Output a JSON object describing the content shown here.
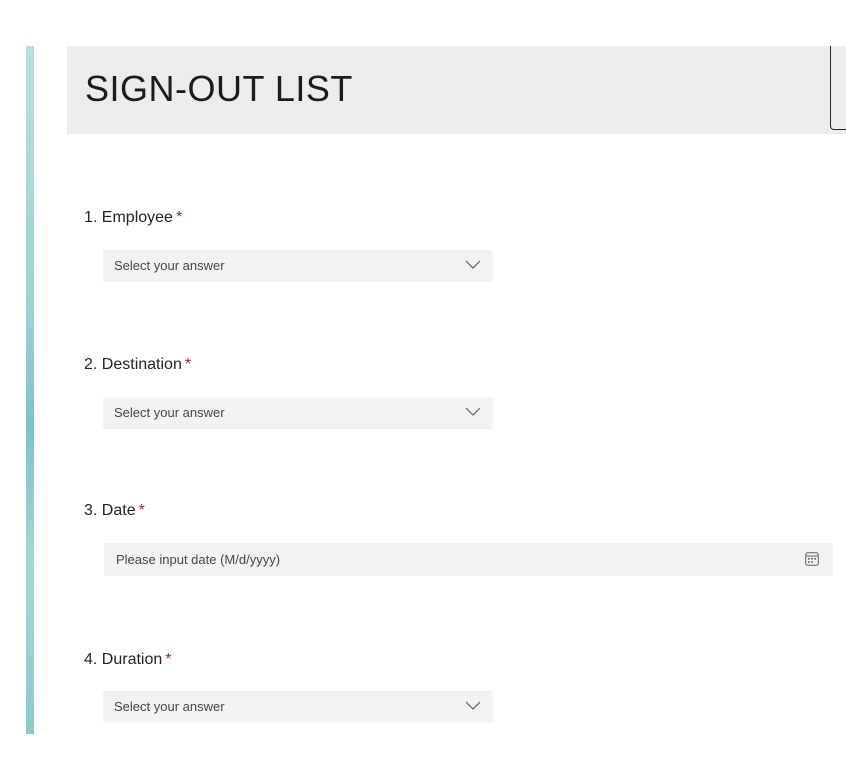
{
  "form": {
    "title": "SIGN-OUT LIST",
    "accent_color": "#9dd0d2",
    "required_marker_color": "#a4262c"
  },
  "questions": [
    {
      "label": "1. Employee",
      "required": "*",
      "type": "dropdown",
      "placeholder": "Select your answer",
      "icon": "chevron-down-icon"
    },
    {
      "label": "2. Destination",
      "required": "*",
      "type": "dropdown",
      "placeholder": "Select your answer",
      "icon": "chevron-down-icon"
    },
    {
      "label": "3. Date",
      "required": "*",
      "type": "date",
      "placeholder": "Please input date (M/d/yyyy)",
      "icon": "calendar-icon"
    },
    {
      "label": "4. Duration",
      "required": "*",
      "type": "dropdown",
      "placeholder": "Select your answer",
      "icon": "chevron-down-icon"
    }
  ]
}
